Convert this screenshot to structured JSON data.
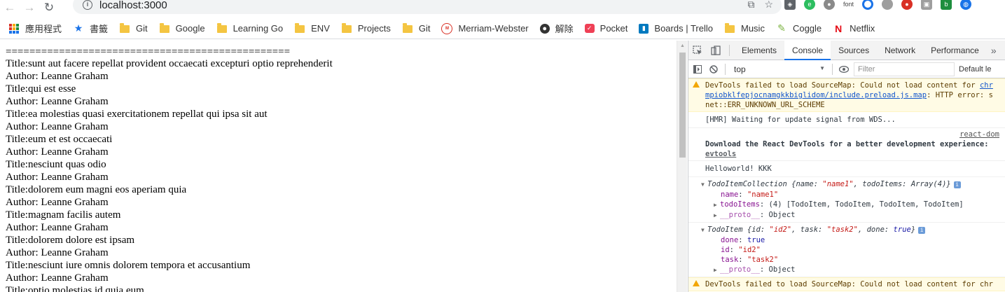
{
  "browser": {
    "url": "localhost:3000",
    "extensions": [
      "translate-icon",
      "star-icon",
      "shield-icon",
      "evernote-icon",
      "pocket-elephant-icon",
      "font-label",
      "ring-icon",
      "circle-icon",
      "record-icon",
      "camera-icon",
      "link-icon",
      "globe-icon"
    ],
    "font_label": "font"
  },
  "bookmarks": [
    {
      "label": "應用程式",
      "icon": "apps-grid-icon"
    },
    {
      "label": "書籤",
      "icon": "star-icon"
    },
    {
      "label": "Git",
      "icon": "folder-icon"
    },
    {
      "label": "Google",
      "icon": "folder-icon"
    },
    {
      "label": "Learning Go",
      "icon": "folder-icon"
    },
    {
      "label": "ENV",
      "icon": "folder-icon"
    },
    {
      "label": "Projects",
      "icon": "folder-icon"
    },
    {
      "label": "Git",
      "icon": "folder-icon"
    },
    {
      "label": "Merriam-Webster",
      "icon": "mw-icon"
    },
    {
      "label": "解除",
      "icon": "github-icon"
    },
    {
      "label": "Pocket",
      "icon": "pocket-icon"
    },
    {
      "label": "Boards | Trello",
      "icon": "trello-icon"
    },
    {
      "label": "Music",
      "icon": "folder-icon"
    },
    {
      "label": "Coggle",
      "icon": "coggle-icon"
    },
    {
      "label": "Netflix",
      "icon": "netflix-icon"
    }
  ],
  "page": {
    "rule": "================================================",
    "lines": [
      "Title:sunt aut facere repellat provident occaecati excepturi optio reprehenderit",
      "Author: Leanne Graham",
      "Title:qui est esse",
      "Author: Leanne Graham",
      "Title:ea molestias quasi exercitationem repellat qui ipsa sit aut",
      "Author: Leanne Graham",
      "Title:eum et est occaecati",
      "Author: Leanne Graham",
      "Title:nesciunt quas odio",
      "Author: Leanne Graham",
      "Title:dolorem eum magni eos aperiam quia",
      "Author: Leanne Graham",
      "Title:magnam facilis autem",
      "Author: Leanne Graham",
      "Title:dolorem dolore est ipsam",
      "Author: Leanne Graham",
      "Title:nesciunt iure omnis dolorem tempora et accusantium",
      "Author: Leanne Graham",
      "Title:optio molestias id quia eum"
    ]
  },
  "devtools": {
    "tabs": [
      "Elements",
      "Console",
      "Sources",
      "Network",
      "Performance"
    ],
    "active_tab": "Console",
    "more": "»",
    "context": "top",
    "filter_placeholder": "Filter",
    "levels": "Default le",
    "console": {
      "warn1_line1": "DevTools failed to load SourceMap: Could not load content for ",
      "warn1_link1": "chr",
      "warn1_line2_link": "mpiobklfepjocnamgkkbiglidom/include.preload.js.map",
      "warn1_line2_rest": ": HTTP error: s",
      "warn1_line3": "net::ERR_UNKNOWN_URL_SCHEME",
      "hmr": "[HMR] Waiting for update signal from WDS...",
      "react_source": "react-dom",
      "react_msg": "Download the React DevTools for a better development experience: ",
      "react_link": "evtools",
      "hello": "Helloworld! KKK",
      "coll_name": "TodoItemCollection",
      "coll_summary_pre": " {name: ",
      "coll_summary_name": "\"name1\"",
      "coll_summary_mid": ", todoItems: Array(4)}",
      "coll_prop_name_key": "name",
      "coll_prop_name_val": "\"name1\"",
      "coll_prop_items_key": "todoItems",
      "coll_prop_items_val": " (4) [TodoItem, TodoItem, TodoItem, TodoItem]",
      "proto_key": "__proto__",
      "proto_val": " Object",
      "item_name": "TodoItem",
      "item_summary_pre": " {id: ",
      "item_summary_id": "\"id2\"",
      "item_summary_mid": ", task: ",
      "item_summary_task": "\"task2\"",
      "item_summary_mid2": ", done: ",
      "item_summary_done": "true",
      "item_summary_end": "}",
      "item_done_key": "done",
      "item_done_val": "true",
      "item_id_key": "id",
      "item_id_val": "\"id2\"",
      "item_task_key": "task",
      "item_task_val": "\"task2\"",
      "warn2": "DevTools failed to load SourceMap: Could not load content for chr"
    }
  }
}
